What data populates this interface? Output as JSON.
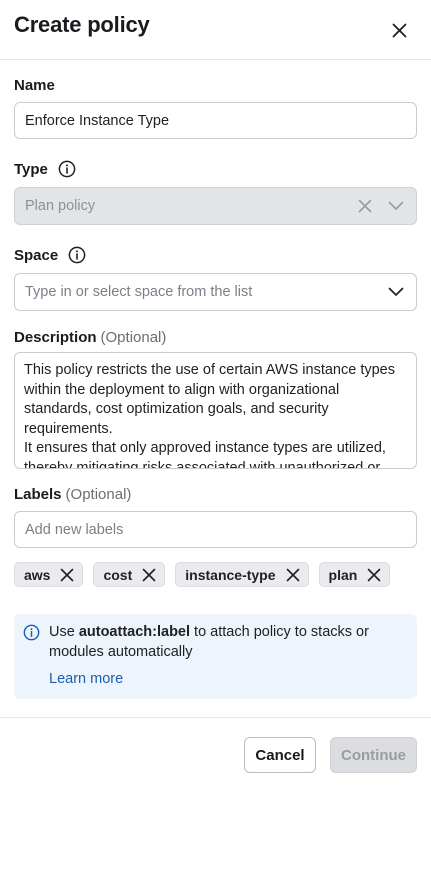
{
  "header": {
    "title": "Create policy",
    "close_icon": "close-icon"
  },
  "name": {
    "label": "Name",
    "value": "Enforce Instance Type"
  },
  "type": {
    "label": "Type",
    "info_icon": "info-icon",
    "value": "Plan policy",
    "disabled": true
  },
  "space": {
    "label": "Space",
    "info_icon": "info-icon",
    "placeholder": "Type in or select space from the list"
  },
  "description": {
    "label": "Description",
    "optional": "(Optional)",
    "text": "This policy restricts the use of certain AWS instance types within the deployment to align with organizational standards, cost optimization goals, and security requirements.\nIt ensures that only approved instance types are utilized, thereby mitigating risks associated with unauthorized or"
  },
  "labels": {
    "label": "Labels",
    "optional": "(Optional)",
    "placeholder": "Add new labels",
    "tags": [
      "aws",
      "cost",
      "instance-type",
      "plan"
    ]
  },
  "callout": {
    "prefix": "Use ",
    "keyword": "autoattach:label",
    "suffix": " to attach policy to stacks or modules automatically",
    "link": "Learn more"
  },
  "footer": {
    "cancel": "Cancel",
    "continue": "Continue"
  },
  "colors": {
    "accent": "#1a5fb4",
    "disabled_bg": "#e3e4e8",
    "callout_bg": "#eef4fb"
  }
}
